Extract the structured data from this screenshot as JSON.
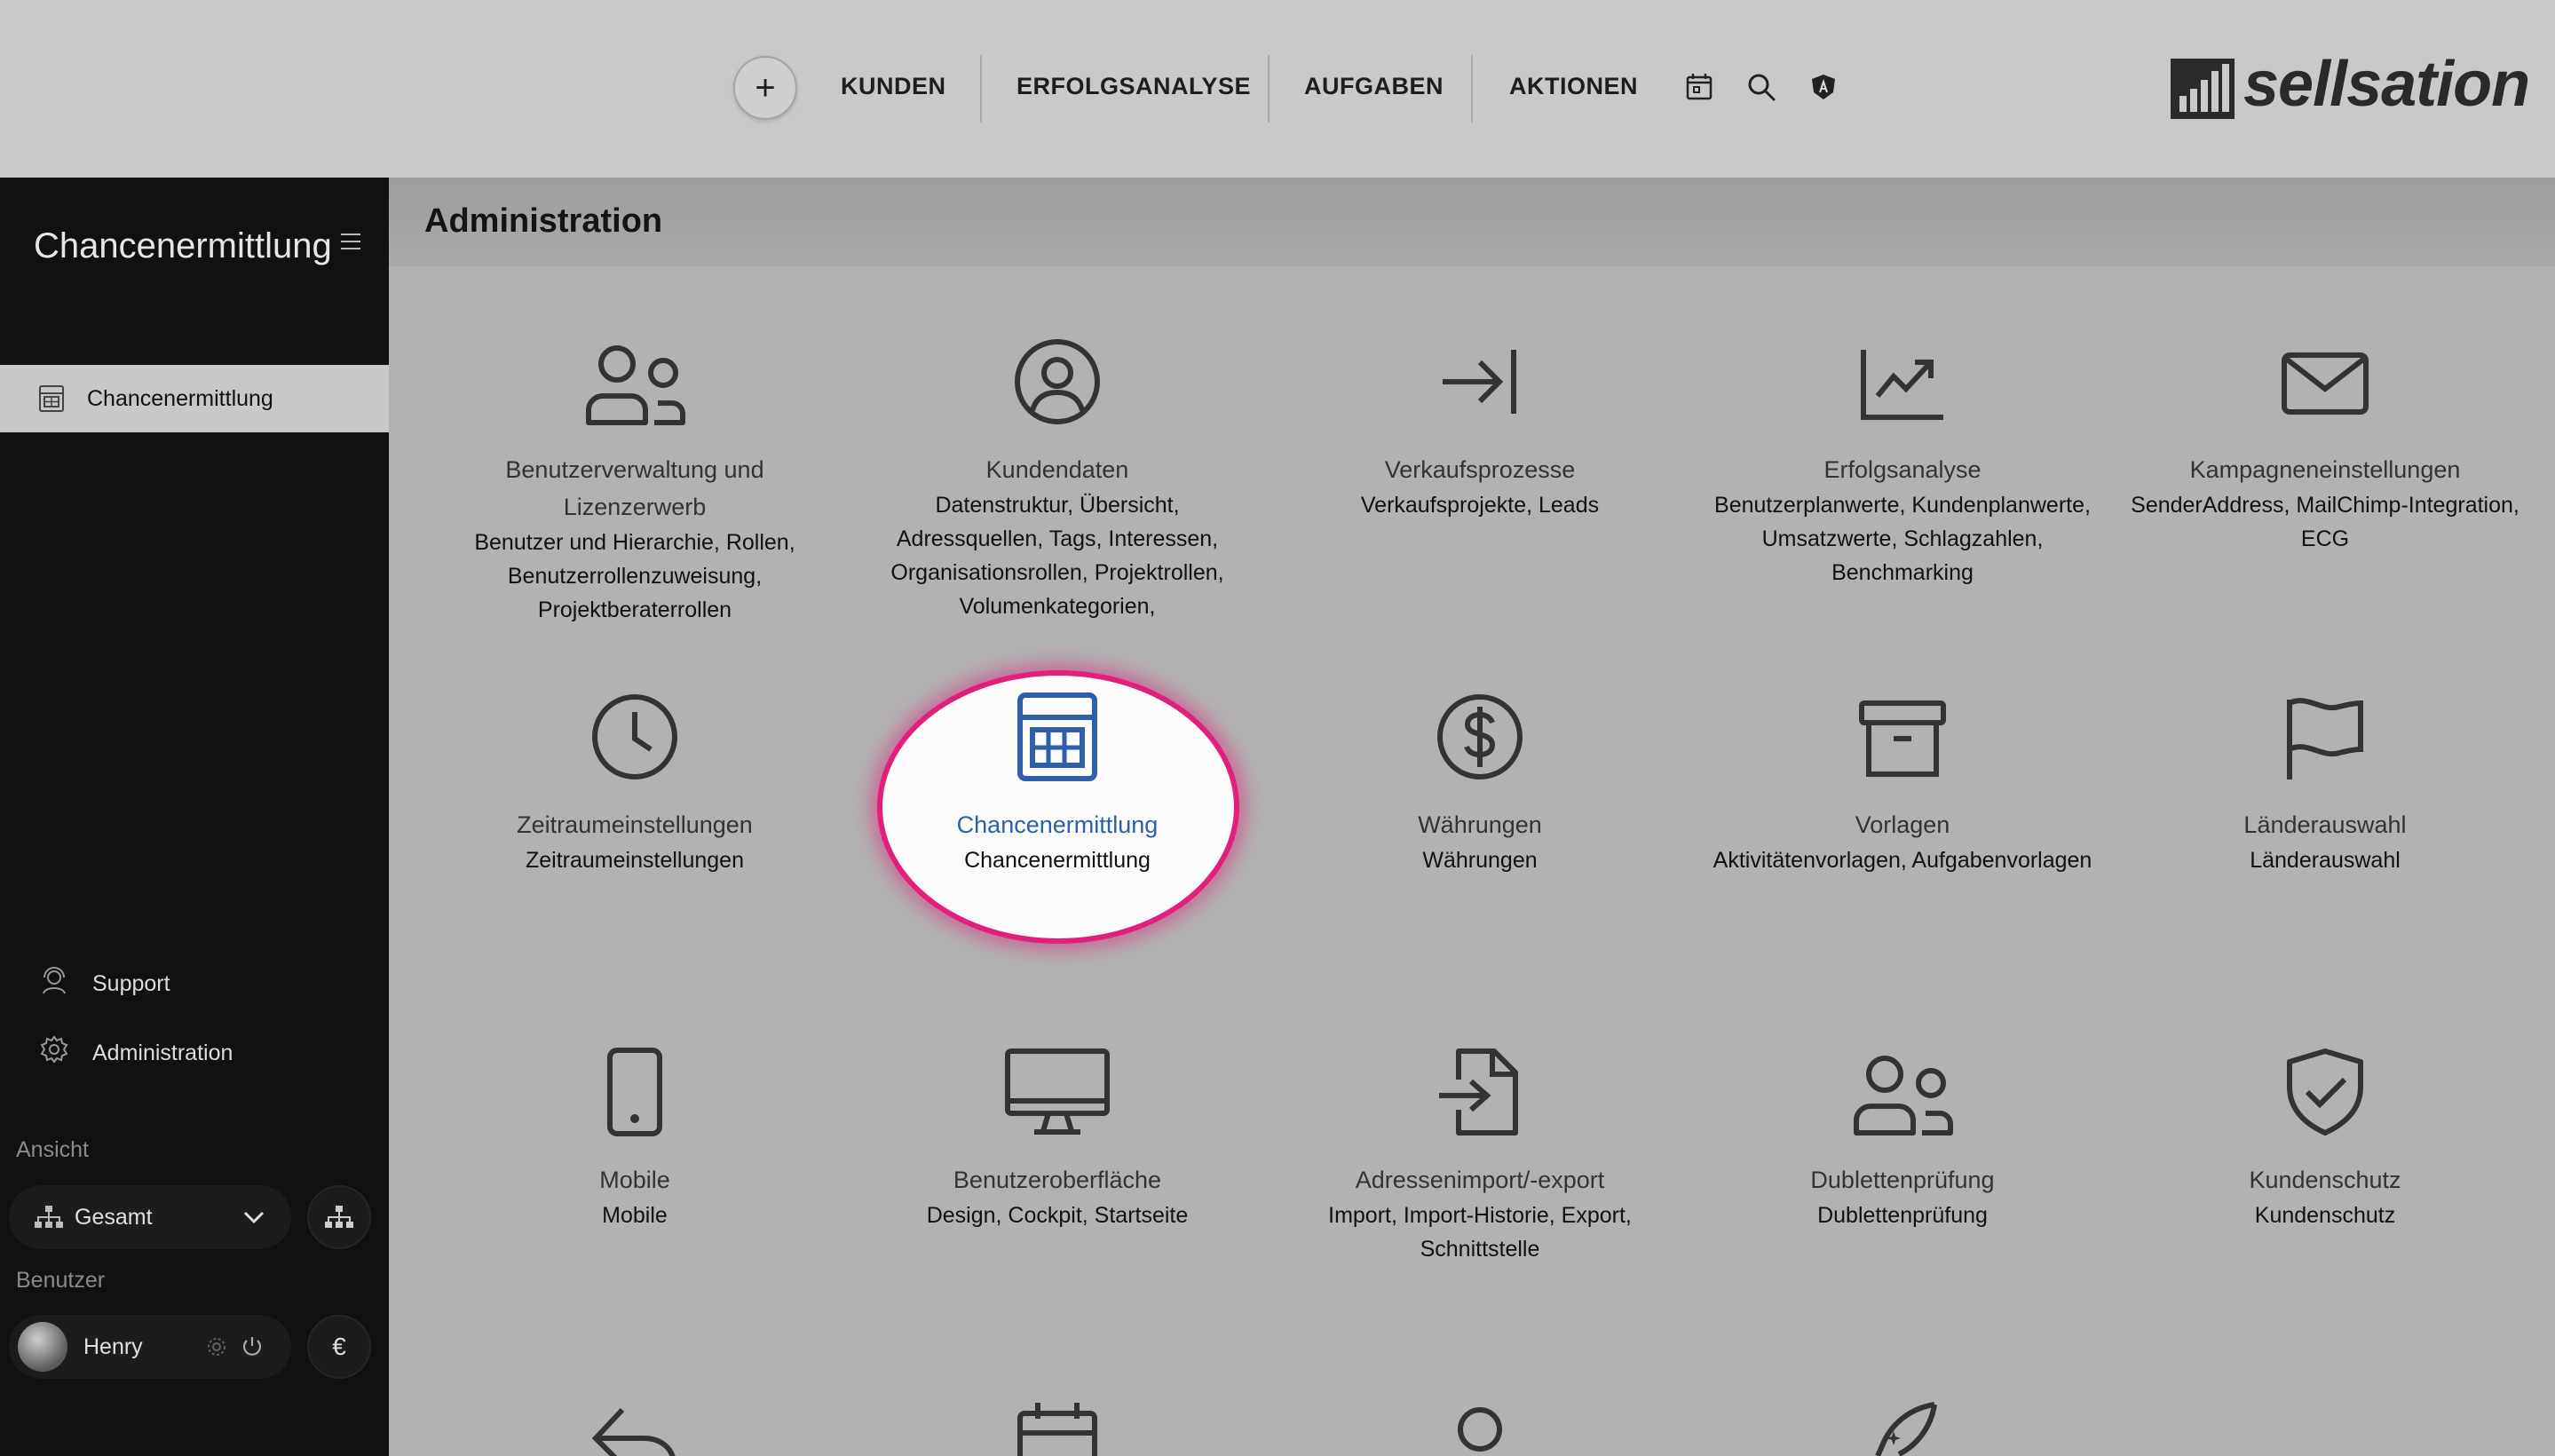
{
  "topnav": {
    "add_label": "+",
    "items": [
      "KUNDEN",
      "ERFOLGSANALYSE",
      "AUFGABEN",
      "AKTIONEN"
    ],
    "icons": [
      "calendar-icon",
      "search-icon",
      "shield-icon"
    ],
    "logo_text": "sellsation"
  },
  "sidebar": {
    "title": "Chancenermittlung",
    "active_item": "Chancenermittlung",
    "links": [
      "Support",
      "Administration"
    ],
    "view_caption": "Ansicht",
    "view_value": "Gesamt",
    "user_caption": "Benutzer",
    "user_name": "Henry",
    "currency_label": "€"
  },
  "main": {
    "title": "Administration",
    "tiles": [
      {
        "title": "Benutzerverwaltung und Lizenzerwerb",
        "subtitle": "Benutzer und Hierarchie, Rollen, Benutzerrollenzuweisung, Projektberaterrollen",
        "icon": "users-icon"
      },
      {
        "title": "Kundendaten",
        "subtitle": "Datenstruktur, Übersicht, Adressquellen, Tags, Interessen, Organisationsrollen, Projektrollen, Volumenkategorien,",
        "icon": "user-circle-icon"
      },
      {
        "title": "Verkaufsprozesse",
        "subtitle": "Verkaufsprojekte, Leads",
        "icon": "arrow-to-line-icon"
      },
      {
        "title": "Erfolgsanalyse",
        "subtitle": "Benutzerplanwerte, Kundenplanwerte, Umsatzwerte, Schlagzahlen, Benchmarking",
        "icon": "chart-line-icon"
      },
      {
        "title": "Kampagneneinstellungen",
        "subtitle": "SenderAddress, MailChimp-Integration, ECG",
        "icon": "envelope-icon"
      },
      {
        "title": "Zeitraumeinstellungen",
        "subtitle": "Zeitraumeinstellungen",
        "icon": "clock-icon"
      },
      {
        "title": "Chancenermittlung",
        "subtitle": "Chancenermittlung",
        "icon": "calculator-icon"
      },
      {
        "title": "Währungen",
        "subtitle": "Währungen",
        "icon": "dollar-icon"
      },
      {
        "title": "Vorlagen",
        "subtitle": "Aktivitätenvorlagen, Aufgabenvorlagen",
        "icon": "archive-icon"
      },
      {
        "title": "Länderauswahl",
        "subtitle": "Länderauswahl",
        "icon": "flag-icon"
      },
      {
        "title": "Mobile",
        "subtitle": "Mobile",
        "icon": "mobile-icon"
      },
      {
        "title": "Benutzeroberfläche",
        "subtitle": "Design, Cockpit, Startseite",
        "icon": "desktop-icon"
      },
      {
        "title": "Adressenimport/-export",
        "subtitle": "Import, Import-Historie, Export, Schnittstelle",
        "icon": "file-import-icon"
      },
      {
        "title": "Dublettenprüfung",
        "subtitle": "Dublettenprüfung",
        "icon": "users-duplicate-icon"
      },
      {
        "title": "Kundenschutz",
        "subtitle": "Kundenschutz",
        "icon": "shield-check-icon"
      }
    ],
    "highlight_color": "#e0207a",
    "accent_color": "#2f5fa8"
  }
}
